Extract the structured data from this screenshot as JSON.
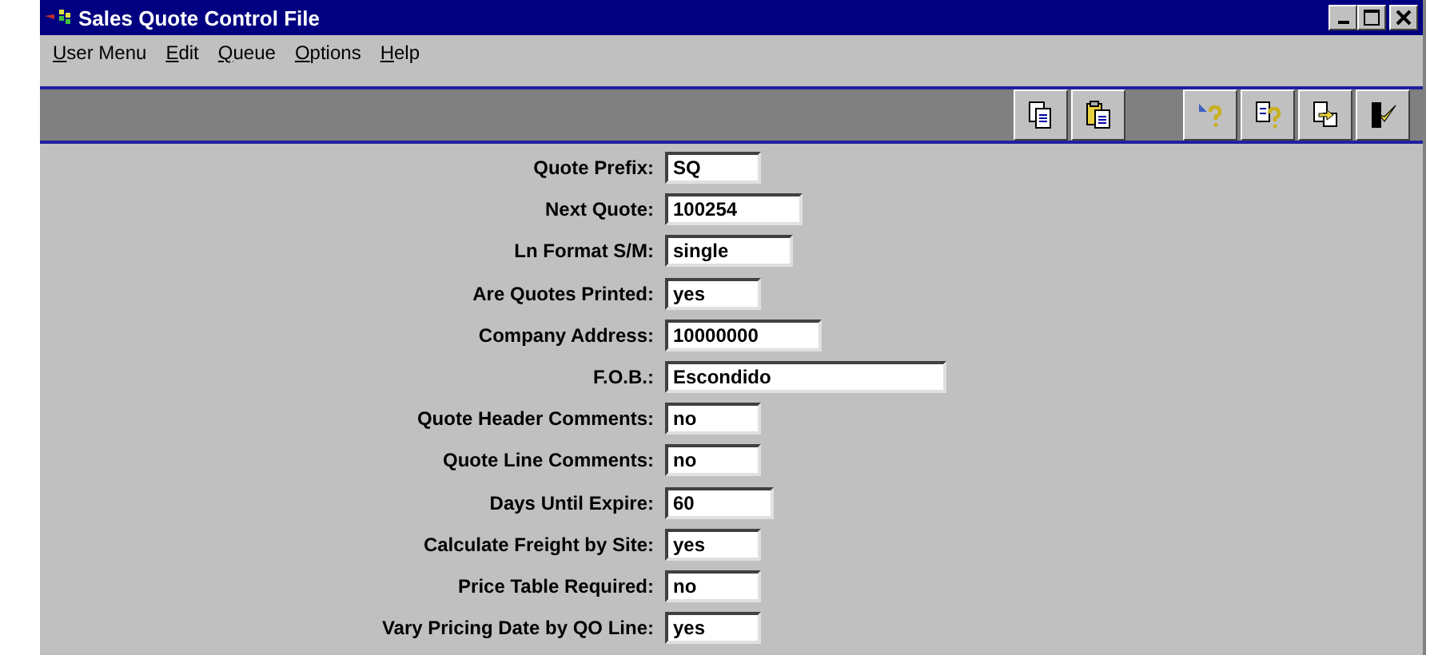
{
  "window": {
    "title": "Sales Quote Control File"
  },
  "menu": [
    {
      "label": "User Menu"
    },
    {
      "label": "Edit"
    },
    {
      "label": "Queue"
    },
    {
      "label": "Options"
    },
    {
      "label": "Help"
    }
  ],
  "fields": [
    {
      "label": "Quote Prefix:",
      "value": "SQ"
    },
    {
      "label": "Next Quote:",
      "value": "100254"
    },
    {
      "label": "Ln Format S/M:",
      "value": "single"
    },
    {
      "label": "Are Quotes Printed:",
      "value": "yes"
    },
    {
      "label": "Company Address:",
      "value": "10000000"
    },
    {
      "label": "F.O.B.:",
      "value": "Escondido"
    },
    {
      "label": "Quote Header Comments:",
      "value": "no"
    },
    {
      "label": "Quote Line Comments:",
      "value": "no"
    },
    {
      "label": "Days Until Expire:",
      "value": "60"
    },
    {
      "label": "Calculate Freight by Site:",
      "value": "yes"
    },
    {
      "label": "Price Table Required:",
      "value": "no"
    },
    {
      "label": "Vary Pricing Date by QO Line:",
      "value": "yes"
    }
  ]
}
